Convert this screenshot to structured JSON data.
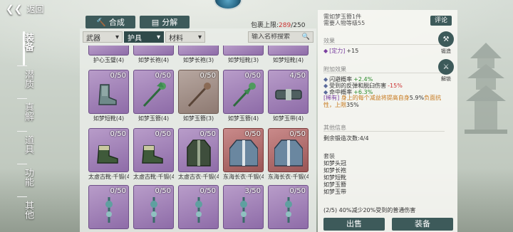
{
  "top": {
    "back_label": "返回"
  },
  "categories": [
    "装备",
    "潜质",
    "真解",
    "道具",
    "功能",
    "其他"
  ],
  "actions": {
    "compose_label": "合成",
    "decompose_label": "分解"
  },
  "capacity": {
    "label": "包裹上限:",
    "used": "289",
    "sep": "/",
    "max": "250"
  },
  "filters": [
    {
      "label": "武器",
      "active": false
    },
    {
      "label": "护具",
      "active": true
    },
    {
      "label": "材料",
      "active": false
    }
  ],
  "search": {
    "placeholder": "输入名称搜索"
  },
  "rows": [
    [
      {
        "name": "护心玉璧(4)",
        "count": ""
      },
      {
        "name": "如梦长袍(4)",
        "count": ""
      },
      {
        "name": "如梦长袍(3)",
        "count": ""
      },
      {
        "name": "如梦短靴(3)",
        "count": ""
      },
      {
        "name": "如梦短靴(4)",
        "count": ""
      }
    ],
    [
      {
        "name": "如梦短靴(4)",
        "count": "0/50",
        "icon": "boots"
      },
      {
        "name": "如梦玉簪(4)",
        "count": "0/50",
        "icon": "hairpin"
      },
      {
        "name": "如梦玉簪(3)",
        "count": "0/50",
        "icon": "hairpin"
      },
      {
        "name": "如梦玉簪(4)",
        "count": "0/50",
        "icon": "hairpin"
      },
      {
        "name": "如梦玉带(4)",
        "count": "4/50",
        "icon": "belt"
      }
    ],
    [
      {
        "name": "太虚古靴·千锻(4)",
        "count": "0/50",
        "icon": "boots"
      },
      {
        "name": "太虚古靴·千锻(4)",
        "count": "0/50",
        "icon": "boots"
      },
      {
        "name": "太虚古衣·千锻(4)",
        "count": "0/50",
        "icon": "robe"
      },
      {
        "name": "东海长衣·千锻(4)",
        "count": "0/50",
        "icon": "robe-red"
      },
      {
        "name": "东海长衣·千锻(4)",
        "count": "0/50",
        "icon": "robe-red"
      }
    ],
    [
      {
        "name": "",
        "count": "0/50",
        "icon": "pendant"
      },
      {
        "name": "",
        "count": "0/50",
        "icon": "pendant"
      },
      {
        "name": "",
        "count": "0/50",
        "icon": "pendant"
      },
      {
        "name": "",
        "count": "3/50",
        "icon": "pendant"
      },
      {
        "name": "",
        "count": "0/50",
        "icon": "pendant"
      }
    ]
  ],
  "detail": {
    "title_partial": "需如梦玉簪1件",
    "level_req": "需要人物等级55",
    "review_label": "评论",
    "effect_title": "效果",
    "effect_attr": "[定力]",
    "effect_value": "+15",
    "extra_title": "附加效果",
    "extra1_label": "闪避概率",
    "extra1_value": "+2.4%",
    "extra2_label": "受到的反弹和脱臼伤害",
    "extra2_value": "-15%",
    "extra3_label": "命中概率",
    "extra3_value": "+6.3%",
    "special_tag": "[稀有]",
    "special_text": "身上的每个减益将提高自身",
    "special_value": "5.9%",
    "special_text2": "负面抗性，上限",
    "special_cap": "35%",
    "other_title": "其他信息",
    "forge_left": "剩余锻造次数:4/4",
    "set_title": "套装",
    "set_items": [
      "如梦头冠",
      "如梦长袍",
      "如梦短靴",
      "如梦玉簪",
      "如梦玉带"
    ],
    "set_bonus": "(2/5) 40%减少20%受到的普通伤害",
    "sell_label": "出售",
    "equip_label": "装备",
    "side_forge": "锻造",
    "side_unlock": "解锁"
  }
}
